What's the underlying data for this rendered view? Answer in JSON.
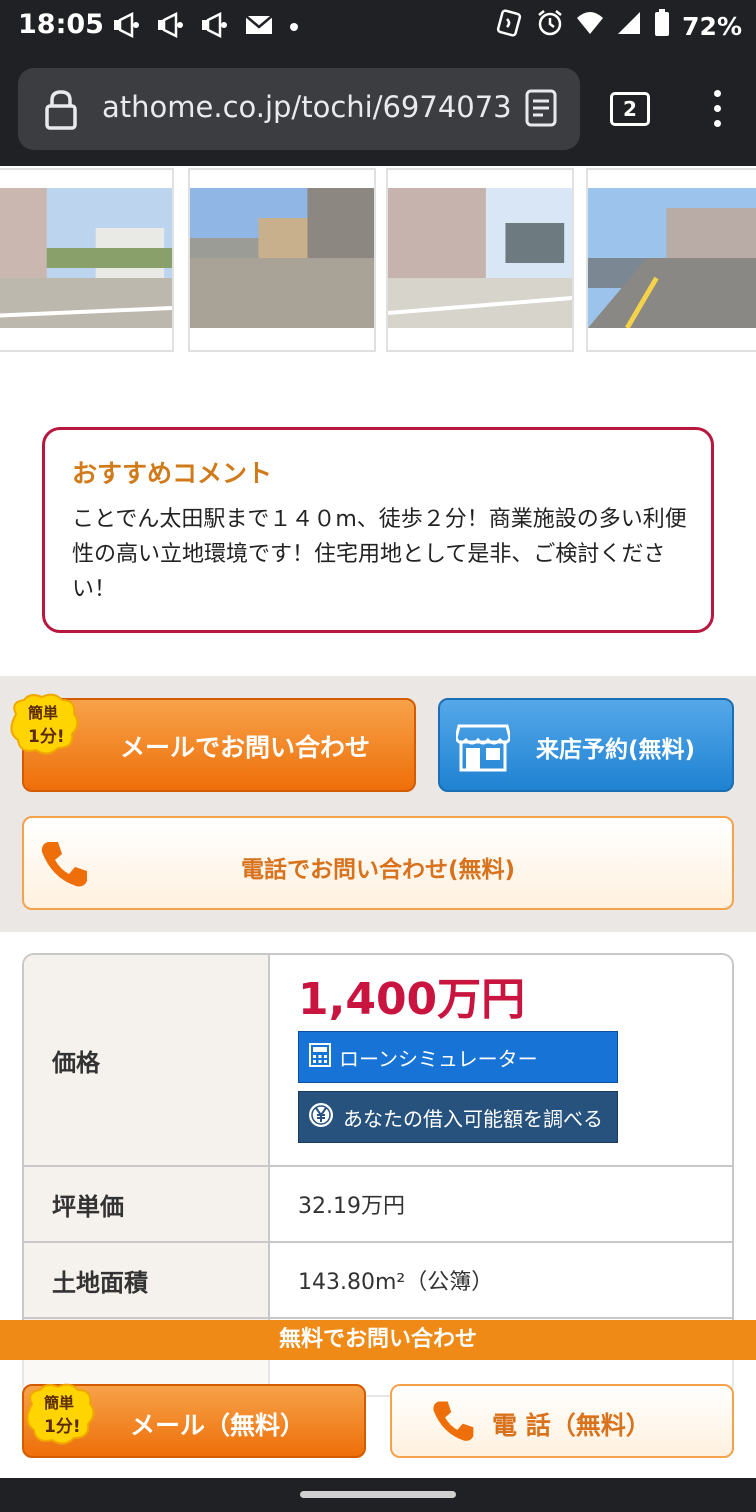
{
  "status_bar": {
    "time": "18:05",
    "battery": "72%",
    "icons": [
      "megaphone-icon",
      "megaphone-icon",
      "megaphone-icon",
      "mail-icon",
      "dot-icon",
      "nfc-icon",
      "alarm-icon",
      "wifi-icon",
      "signal-icon",
      "battery-icon"
    ]
  },
  "browser": {
    "url": "athome.co.jp/tochi/6974073",
    "tab_count": "2"
  },
  "recommend": {
    "title": "おすすめコメント",
    "text": "ことでん太田駅まで１４０m、徒歩２分！商業施設の多い利便性の高い立地環境です！住宅用地として是非、ご検討ください！"
  },
  "contact": {
    "badge_line1": "簡単",
    "badge_line2": "1分!",
    "mail_label": "メールでお問い合わせ",
    "visit_label": "来店予約(無料)",
    "tel_label": "電話でお問い合わせ(無料)"
  },
  "info": {
    "price_label": "価格",
    "price_value": "1,400万円",
    "loan_button": "ローンシミュレーター",
    "borrow_button": "あなたの借入可能額を調べる",
    "unit_price_label": "坪単価",
    "unit_price_value": "32.19万円",
    "land_area_label": "土地面積",
    "land_area_value": "143.80m²（公簿）"
  },
  "sticky": {
    "header": "無料でお問い合わせ",
    "mail_label": "メール（無料）",
    "tel_label": "電 話（無料）"
  },
  "colors": {
    "accent_orange": "#ee6f09",
    "accent_blue": "#1f82d2",
    "price_red": "#c8143e",
    "comment_border": "#b8173f"
  }
}
